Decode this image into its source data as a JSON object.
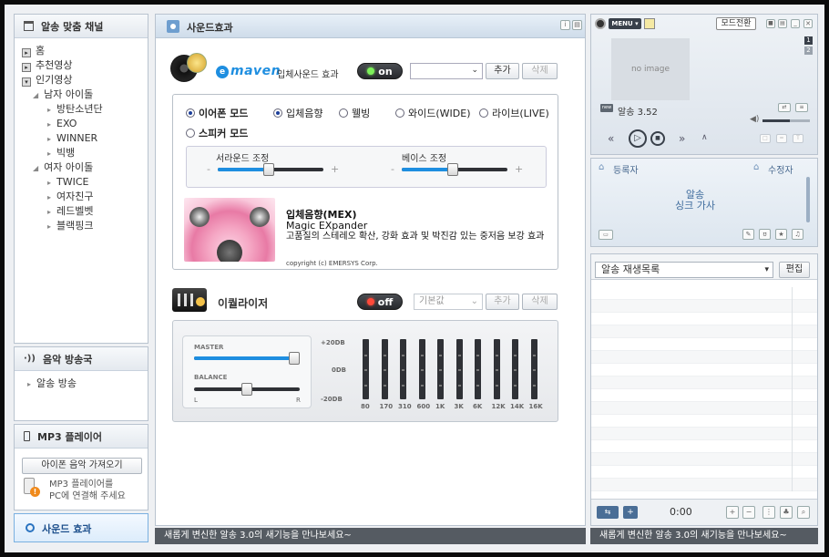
{
  "sidebar": {
    "section_title": "알송 맞춤 채널",
    "items": [
      "홈",
      "추천영상",
      "인기영상"
    ],
    "sub_male": "남자 아이돌",
    "male_items": [
      "방탄소년단",
      "EXO",
      "WINNER",
      "빅뱅"
    ],
    "sub_female": "여자 아이돌",
    "female_items": [
      "TWICE",
      "여자친구",
      "레드벨벳",
      "블랙핑크"
    ],
    "radio_title": "음악 방송국",
    "radio_item": "알송 방송",
    "mp3_title": "MP3 플레이어",
    "mp3_button": "아이폰 음악 가져오기",
    "mp3_notice_1": "MP3 플레이어를",
    "mp3_notice_2": "PC에 연결해 주세요",
    "sound_effect": "사운드 효과"
  },
  "main": {
    "title": "사운드효과",
    "maven_logo": "maven",
    "maven_label": "입체사운드 효과",
    "maven_toggle": "on",
    "add": "추가",
    "delete": "삭제",
    "modes": {
      "earphone": "이어폰 모드",
      "speaker": "스피커 모드",
      "stereo": "입체음향",
      "wellbeing": "웰빙",
      "wide": "와이드(WIDE)",
      "live": "라이브(LIVE)"
    },
    "surround_label": "서라운드 조정",
    "bass_label": "베이스 조정",
    "surround_level": 0.48,
    "bass_level": 0.48,
    "mex_title": "입체음향(MEX)",
    "mex_sub": "Magic EXpander",
    "mex_desc": "고품질의 스테레오 확산, 강화 효과 및 박진감 있는 중저음 보강 효과",
    "copyright": "copyright (c) EMERSYS Corp.",
    "eq_title": "이퀄라이저",
    "eq_toggle": "off",
    "eq_preset": "기본값",
    "master_label": "MASTER",
    "balance_label": "BALANCE",
    "balance_l": "L",
    "balance_r": "R",
    "master_level": 1.0,
    "balance_level": 0.5,
    "db_top": "+20DB",
    "db_mid": "0DB",
    "db_bottom": "-20DB",
    "bands": [
      "80",
      "170",
      "310",
      "600",
      "1K",
      "3K",
      "6K",
      "12K",
      "14K",
      "16K"
    ]
  },
  "player": {
    "menu": "MENU",
    "mode_switch": "모드전환",
    "no_image": "no image",
    "track": "알송 3.52",
    "registrant": "등록자",
    "editor": "수정자",
    "lyrics_1": "알송",
    "lyrics_2": "싱크 가사",
    "playlist_name": "알송 재생목록",
    "edit": "편집",
    "time": "0:00"
  },
  "status": {
    "message": "새롭게 변신한 알송 3.0의 새기능을 만나보세요~"
  },
  "colors": {
    "accent": "#1e8ee0",
    "on_green": "#35c24a",
    "off_red": "#e23b2e",
    "dark_pill": "#2f3136"
  }
}
